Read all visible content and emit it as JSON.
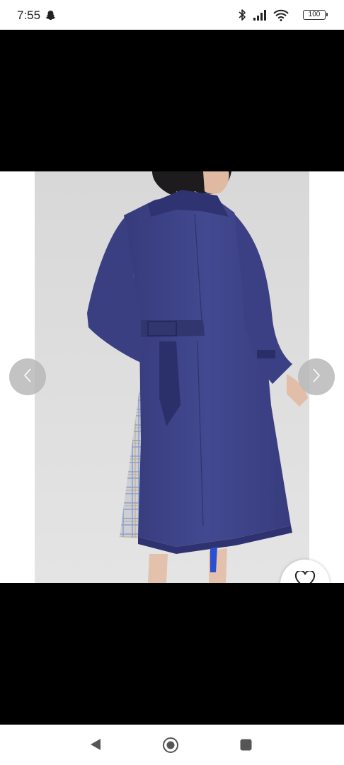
{
  "status_bar": {
    "time": "7:55",
    "left_icons": [
      "snapchat-ghost-icon"
    ],
    "right_icons": [
      "bluetooth-icon",
      "signal-icon",
      "wifi-icon",
      "battery-icon"
    ],
    "battery_level": "100"
  },
  "gallery": {
    "image_description_icon": "product-photo",
    "prev_icon": "chevron-left-icon",
    "next_icon": "chevron-right-icon",
    "favorite_icon": "heart-outline-icon"
  },
  "system_nav": {
    "back_icon": "back-triangle-icon",
    "home_icon": "home-circle-icon",
    "recents_icon": "recents-square-icon"
  },
  "colors": {
    "coat": "#3f4488",
    "backdrop": "#dcdcdc",
    "letterbox": "#000000"
  }
}
